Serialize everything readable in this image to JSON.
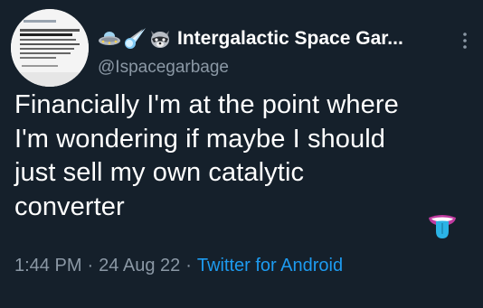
{
  "tweet": {
    "display_name": "Intergalactic Space Gar...",
    "handle": "@Ispacegarbage",
    "text": "Financially I'm at the point where\nI'm wondering if maybe I should\njust sell my own catalytic\nconverter",
    "time": "1:44 PM",
    "date": "24 Aug 22",
    "separator": "·",
    "source": "Twitter for Android",
    "name_emojis": [
      "ufo-icon",
      "comet-icon",
      "raccoon-icon"
    ],
    "body_emoji": "mouth-tongue-icon",
    "more_icon": "vertical-ellipsis-icon"
  },
  "colors": {
    "background": "#15202b",
    "text": "#ffffff",
    "muted": "#8b98a5",
    "link": "#1d9bf0"
  }
}
